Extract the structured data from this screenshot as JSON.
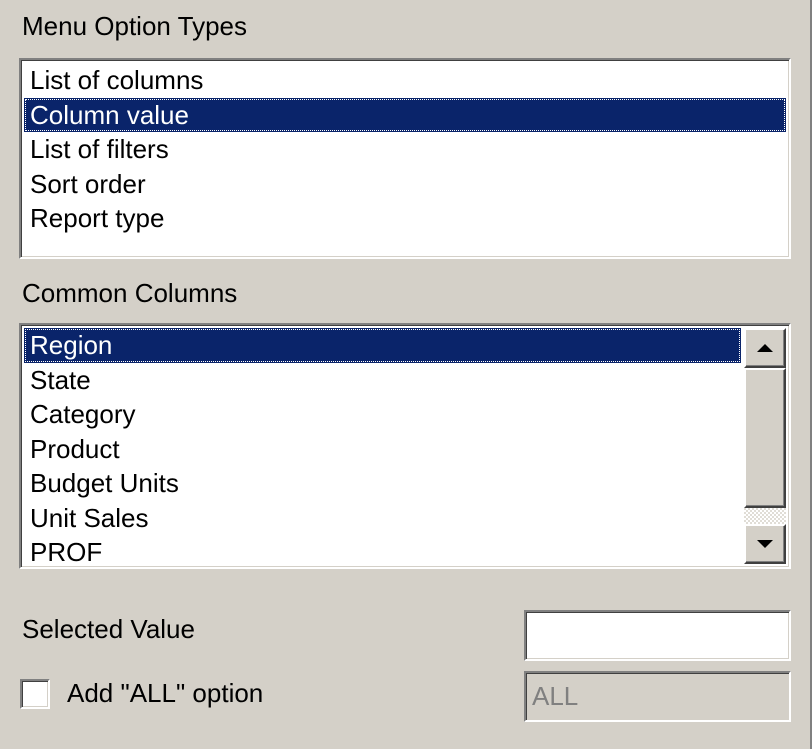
{
  "menu_option_types": {
    "label": "Menu Option Types",
    "items": [
      {
        "label": "List of columns",
        "selected": false
      },
      {
        "label": "Column value",
        "selected": true
      },
      {
        "label": "List of filters",
        "selected": false
      },
      {
        "label": "Sort order",
        "selected": false
      },
      {
        "label": "Report type",
        "selected": false
      }
    ]
  },
  "common_columns": {
    "label": "Common Columns",
    "items": [
      {
        "label": "Region",
        "selected": true
      },
      {
        "label": "State",
        "selected": false
      },
      {
        "label": "Category",
        "selected": false
      },
      {
        "label": "Product",
        "selected": false
      },
      {
        "label": "Budget Units",
        "selected": false
      },
      {
        "label": "Unit Sales",
        "selected": false
      },
      {
        "label": "PROF",
        "selected": false
      }
    ],
    "scroll_up_icon": "arrow-up-icon",
    "scroll_down_icon": "arrow-down-icon"
  },
  "selected_value": {
    "label": "Selected Value",
    "value": ""
  },
  "add_all_option": {
    "label": "Add \"ALL\" option",
    "checked": false,
    "all_value": "ALL",
    "all_enabled": false
  },
  "colors": {
    "background": "#d4d0c8",
    "selection": "#0a246a",
    "selection_text": "#ffffff",
    "disabled_text": "#808080"
  }
}
